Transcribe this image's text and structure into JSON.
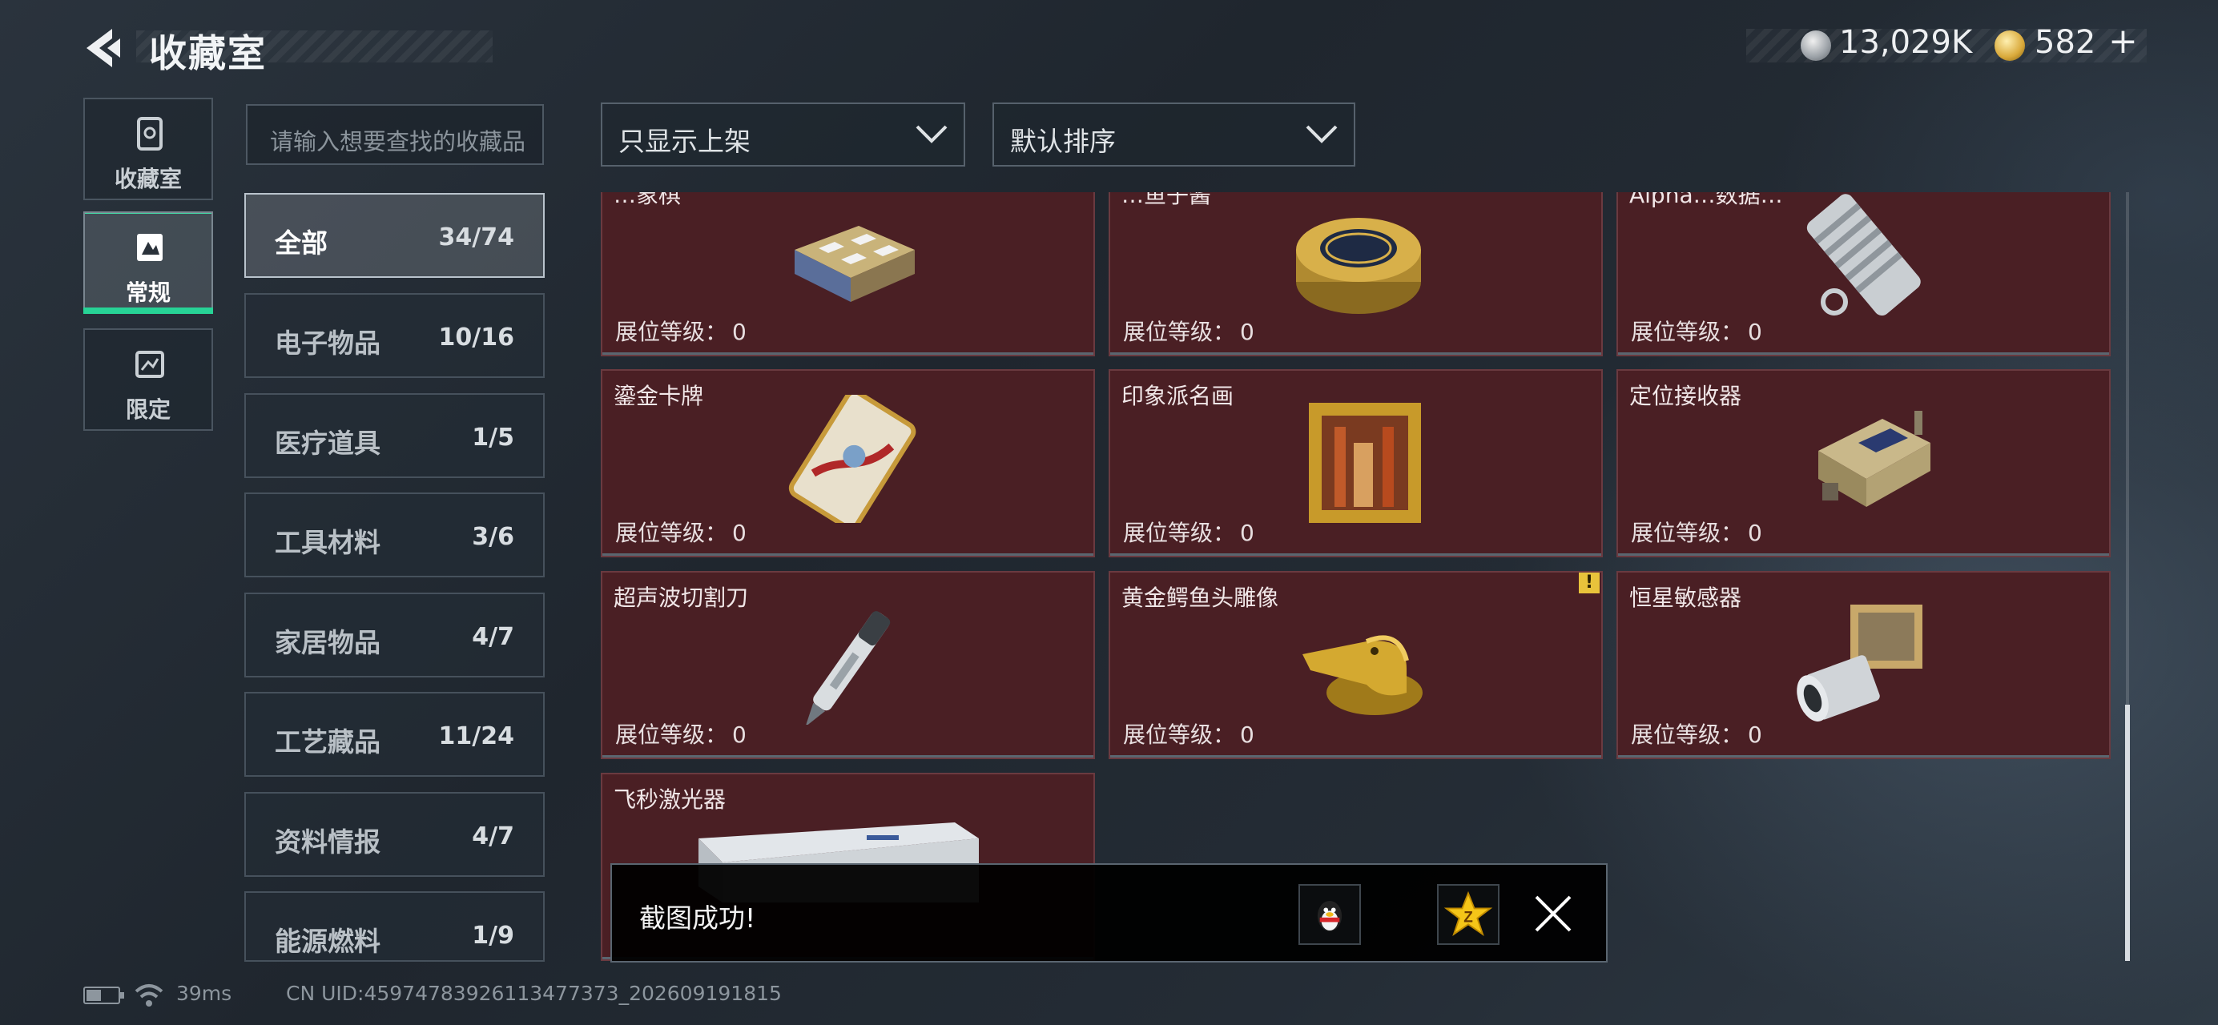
{
  "header": {
    "title": "收藏室",
    "currency": [
      {
        "icon": "silver-coin-icon",
        "value": "13,029K"
      },
      {
        "icon": "gold-coin-icon",
        "value": "582"
      }
    ],
    "add_label": "+"
  },
  "side_tabs": [
    {
      "label": "收藏室",
      "icon": "collection-room-icon",
      "active": false
    },
    {
      "label": "常规",
      "icon": "regular-icon",
      "active": true
    },
    {
      "label": "限定",
      "icon": "limited-icon",
      "active": false
    }
  ],
  "search": {
    "placeholder": "请输入想要查找的收藏品"
  },
  "categories": [
    {
      "name": "全部",
      "count": "34/74",
      "active": true
    },
    {
      "name": "电子物品",
      "count": "10/16"
    },
    {
      "name": "医疗道具",
      "count": "1/5"
    },
    {
      "name": "工具材料",
      "count": "3/6"
    },
    {
      "name": "家居物品",
      "count": "4/7"
    },
    {
      "name": "工艺藏品",
      "count": "11/24"
    },
    {
      "name": "资料情报",
      "count": "4/7"
    },
    {
      "name": "能源燃料",
      "count": "1/9"
    }
  ],
  "filters": {
    "shelf_filter": "只显示上架",
    "sort": "默认排序"
  },
  "level_label": "展位等级：",
  "items": [
    {
      "name": "…象棋",
      "level": "0",
      "art": "chess-box"
    },
    {
      "name": "…鱼子酱",
      "level": "0",
      "art": "caviar-tin"
    },
    {
      "name": "Alpha…数据…",
      "level": "0",
      "art": "data-drive"
    },
    {
      "name": "鎏金卡牌",
      "level": "0",
      "art": "gilded-card"
    },
    {
      "name": "印象派名画",
      "level": "0",
      "art": "painting"
    },
    {
      "name": "定位接收器",
      "level": "0",
      "art": "gps-receiver"
    },
    {
      "name": "超声波切割刀",
      "level": "0",
      "art": "ultrasonic-knife"
    },
    {
      "name": "黄金鳄鱼头雕像",
      "level": "0",
      "art": "gold-crocodile",
      "warning": "!"
    },
    {
      "name": "恒星敏感器",
      "level": "0",
      "art": "star-sensor"
    },
    {
      "name": "飞秒激光器",
      "level": "",
      "art": "femto-laser"
    }
  ],
  "toast": {
    "message": "截图成功!"
  },
  "status_bar": {
    "ping": "39ms",
    "uid": "CN UID:4597478392611347737​3_202609191815"
  }
}
